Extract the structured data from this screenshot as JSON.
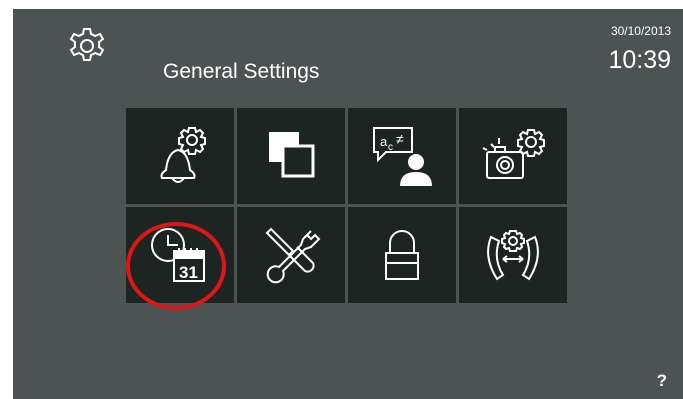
{
  "header": {
    "title": "General Settings",
    "date": "30/10/2013",
    "time": "10:39"
  },
  "tiles": [
    {
      "icon": "ringtone-settings-icon",
      "label": ""
    },
    {
      "icon": "screen-display-icon",
      "label": ""
    },
    {
      "icon": "language-icon",
      "label": ""
    },
    {
      "icon": "camera-settings-icon",
      "label": ""
    },
    {
      "icon": "date-time-icon",
      "label": "31"
    },
    {
      "icon": "tools-icon",
      "label": ""
    },
    {
      "icon": "lock-icon",
      "label": ""
    },
    {
      "icon": "call-transfer-settings-icon",
      "label": ""
    }
  ],
  "help": {
    "label": "?"
  },
  "colors": {
    "background": "#4d5252",
    "tile": "#1d2523",
    "highlight": "#e01515",
    "text": "#ffffff"
  }
}
